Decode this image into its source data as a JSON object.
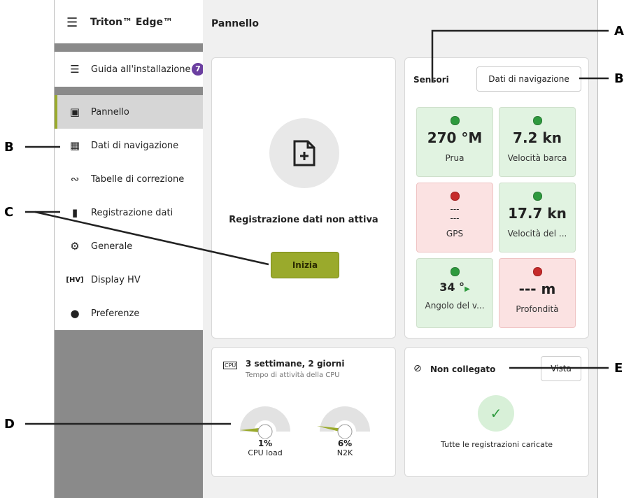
{
  "app": {
    "title": "Triton™ Edge™",
    "menu_icon": "hamburger-icon"
  },
  "sidebar": {
    "guide": {
      "label": "Guida all'installazione",
      "badge": "7"
    },
    "items": [
      {
        "label": "Pannello",
        "icon": "dashboard-icon",
        "active": true
      },
      {
        "label": "Dati di navigazione",
        "icon": "grid-icon"
      },
      {
        "label": "Tabelle di correzione",
        "icon": "chart-icon"
      },
      {
        "label": "Registrazione dati",
        "icon": "file-icon"
      },
      {
        "label": "Generale",
        "icon": "gear-icon"
      },
      {
        "label": "Display HV",
        "icon": "hv-icon"
      },
      {
        "label": "Preferenze",
        "icon": "toggle-icon"
      }
    ]
  },
  "main": {
    "title": "Pannello",
    "recording": {
      "status": "Registrazione dati non attiva",
      "button": "Inizia"
    },
    "sensors": {
      "title": "Sensori",
      "button": "Dati di navigazione",
      "tiles": [
        {
          "value": "270 °M",
          "label": "Prua",
          "status": "ok"
        },
        {
          "value": "7.2 kn",
          "label": "Velocità barca",
          "status": "ok"
        },
        {
          "value": "---\n---",
          "label": "GPS",
          "status": "error"
        },
        {
          "value": "17.7 kn",
          "label": "Velocità del ...",
          "status": "ok"
        },
        {
          "value": "34 °",
          "label": "Angolo del v...",
          "status": "ok"
        },
        {
          "value": "--- m",
          "label": "Profondità",
          "status": "error"
        }
      ]
    },
    "uptime": {
      "title": "3 settimane, 2 giorni",
      "subtitle": "Tempo di attività della CPU",
      "gauges": [
        {
          "value": "1%",
          "label": "CPU load",
          "fraction": 0.01
        },
        {
          "value": "6%",
          "label": "N2K",
          "fraction": 0.06
        }
      ]
    },
    "connection": {
      "status": "Non collegato",
      "button": "Vista",
      "message": "Tutte le registrazioni caricate"
    }
  },
  "annotations": [
    "A",
    "B",
    "B",
    "C",
    "D",
    "E"
  ],
  "colors": {
    "accent": "#9aaa2c",
    "ok": "#e1f3e1",
    "error": "#fbe2e2",
    "badge": "#6b3fa0"
  }
}
